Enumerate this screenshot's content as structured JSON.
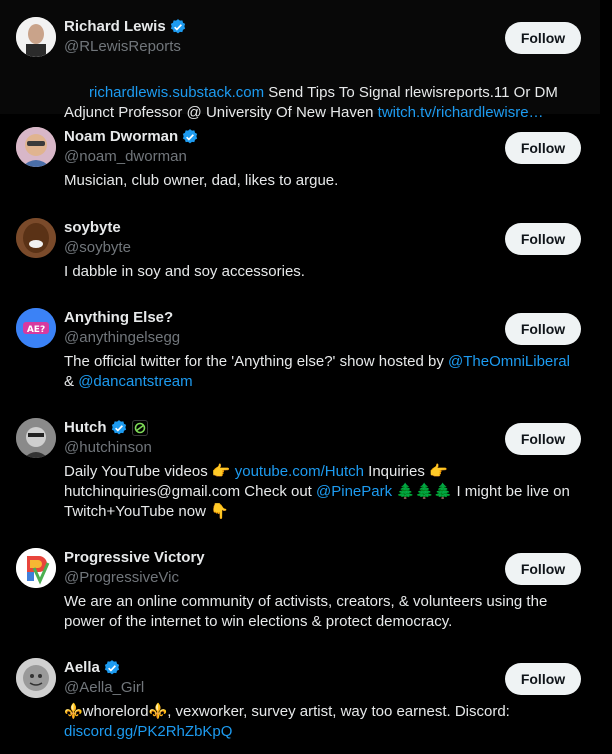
{
  "follow_label": "Follow",
  "users": [
    {
      "name": "Richard Lewis",
      "handle": "@RLewisReports",
      "verified": true,
      "bio_parts": [
        {
          "t": "richardlewis.substack.com",
          "link": true
        },
        {
          "t": " Send Tips To Signal rlewisreports.11 Or DM Adjunct Professor @ University Of New Haven ",
          "link": false
        },
        {
          "t": "twitch.tv/richardlewisre…",
          "link": true
        }
      ]
    },
    {
      "name": "Noam Dworman",
      "handle": "@noam_dworman",
      "verified": true,
      "bio_parts": [
        {
          "t": "Musician, club owner, dad, likes to argue.",
          "link": false
        }
      ]
    },
    {
      "name": "soybyte",
      "handle": "@soybyte",
      "verified": false,
      "bio_parts": [
        {
          "t": "I dabble in soy and soy accessories.",
          "link": false
        }
      ]
    },
    {
      "name": "Anything Else?",
      "handle": "@anythingelsegg",
      "verified": false,
      "bio_parts": [
        {
          "t": "The official twitter for the 'Anything else?' show hosted by ",
          "link": false
        },
        {
          "t": "@TheOmniLiberal",
          "link": true
        },
        {
          "t": " & ",
          "link": false
        },
        {
          "t": "@dancantstream",
          "link": true
        }
      ]
    },
    {
      "name": "Hutch",
      "handle": "@hutchinson",
      "verified": true,
      "affiliate": true,
      "bio_parts": [
        {
          "t": "Daily YouTube videos 👉 ",
          "link": false
        },
        {
          "t": "youtube.com/Hutch",
          "link": true
        },
        {
          "t": " Inquiries 👉 hutchinquiries@gmail.com Check out ",
          "link": false
        },
        {
          "t": "@PinePark",
          "link": true
        },
        {
          "t": " 🌲🌲🌲 I might be live on Twitch+YouTube now 👇",
          "link": false
        }
      ]
    },
    {
      "name": "Progressive Victory",
      "handle": "@ProgressiveVic",
      "verified": false,
      "bio_parts": [
        {
          "t": "We are an online community of activists, creators, & volunteers using the power of the internet to win elections & protect democracy.",
          "link": false
        }
      ]
    },
    {
      "name": "Aella",
      "handle": "@Aella_Girl",
      "verified": true,
      "bio_parts": [
        {
          "t": "⚜️whorelord⚜️, vexworker, survey artist, way too earnest. Discord: ",
          "link": false
        },
        {
          "t": "discord.gg/PK2RhZbKpQ",
          "link": true
        }
      ]
    }
  ],
  "colors": {
    "link": "#1d9bf0",
    "verified": "#1d9bf0",
    "muted": "#71767b"
  }
}
